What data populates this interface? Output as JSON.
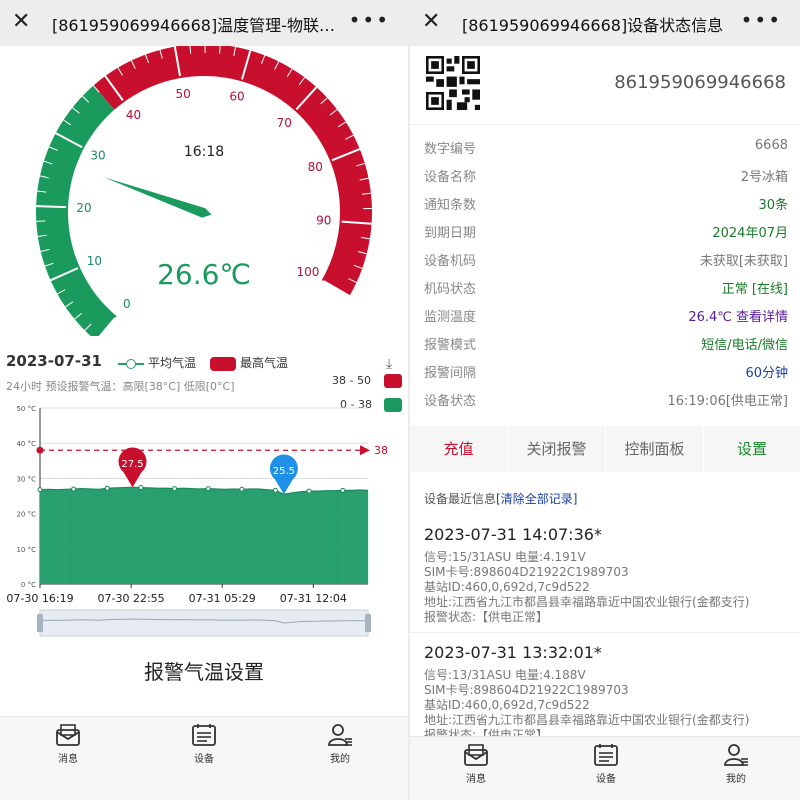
{
  "left": {
    "title": "[861959069946668]温度管理-物联…",
    "gauge": {
      "value": 26.6,
      "value_text": "26.6℃",
      "time": "16:18",
      "min": 0,
      "max": 100,
      "tick_labels": [
        "0",
        "10",
        "20",
        "30",
        "40",
        "50",
        "60",
        "70",
        "80",
        "90",
        "100"
      ],
      "green_until": 38,
      "green_color": "#1a9a5c",
      "red_color": "#c8102e"
    },
    "chart_header": {
      "date": "2023-07-31",
      "legend_avg": "平均气温",
      "legend_max": "最高气温",
      "subtitle": "24小时  预设报警气温：高限[38°C] 低限[0°C]",
      "range_high": "38 - 50",
      "range_low": "0 - 38"
    },
    "chart_data": {
      "type": "area",
      "ylim": [
        0,
        50
      ],
      "y_tick_labels": [
        "50 °C",
        "40 °C",
        "30 °C",
        "20 °C",
        "10 °C",
        "0 °C"
      ],
      "x_tick_labels": [
        "07-30 16:19",
        "07-30 22:55",
        "07-31 05:29",
        "07-31 12:04"
      ],
      "threshold": 38,
      "threshold_label": "38",
      "max_label": "27.5",
      "min_label": "25.5",
      "series": [
        {
          "name": "平均气温",
          "values": [
            26.8,
            26.9,
            26.8,
            26.9,
            27.0,
            27.1,
            27.0,
            26.9,
            27.2,
            27.3,
            27.4,
            27.5,
            27.4,
            27.3,
            27.2,
            27.2,
            27.1,
            27.2,
            27.1,
            27.0,
            27.1,
            27.0,
            26.9,
            27.0,
            26.9,
            27.0,
            27.0,
            26.8,
            26.6,
            25.5,
            25.9,
            26.2,
            26.4,
            26.4,
            26.5,
            26.5,
            26.6,
            26.6,
            26.7,
            26.6
          ]
        }
      ]
    },
    "setting_label": "报警气温设置",
    "tabs": [
      {
        "label": "消息",
        "icon": "message-icon"
      },
      {
        "label": "设备",
        "icon": "device-icon"
      },
      {
        "label": "我的",
        "icon": "profile-icon"
      }
    ]
  },
  "right": {
    "title": "[861959069946668]设备状态信息",
    "device_id": "861959069946668",
    "rows": [
      {
        "key": "数字编号",
        "value": "6668",
        "color": "#777777"
      },
      {
        "key": "设备名称",
        "value": "2号冰箱",
        "color": "#777777"
      },
      {
        "key": "通知条数",
        "value": "30条",
        "color": "#1a7a2a"
      },
      {
        "key": "到期日期",
        "value": "2024年07月",
        "color": "#1a7a2a"
      },
      {
        "key": "设备机码",
        "value": "未获取[未获取]",
        "color": "#777777"
      },
      {
        "key": "机码状态",
        "value": "正常 [在线]",
        "color": "#1a7a2a"
      },
      {
        "key": "监测温度",
        "value": "26.4℃ 查看详情",
        "color": "#5a1a9a"
      },
      {
        "key": "报警模式",
        "value": "短信/电话/微信",
        "color": "#1a7a2a"
      },
      {
        "key": "报警间隔",
        "value": "60分钟",
        "color": "#1a3fa6"
      },
      {
        "key": "设备状态",
        "value": "16:19:06[供电正常]",
        "color": "#777777"
      }
    ],
    "actions": [
      {
        "label": "充值",
        "color": "#c8102e"
      },
      {
        "label": "关闭报警",
        "color": "#666666"
      },
      {
        "label": "控制面板",
        "color": "#666666"
      },
      {
        "label": "设置",
        "color": "#1a8a2a"
      }
    ],
    "logs_head": "设备最近信息",
    "logs_clear": "[清除全部记录]",
    "logs": [
      {
        "time": "2023-07-31 14:07:36*",
        "signal": "信号:15/31ASU 电量:4.191V",
        "sim": "SIM卡号:898604D21922C1989703",
        "station": "基站ID:460,0,692d,7c9d522",
        "address": "地址:江西省九江市都昌县幸福路靠近中国农业银行(金都支行)",
        "status": "报警状态:【供电正常】"
      },
      {
        "time": "2023-07-31 13:32:01*",
        "signal": "信号:13/31ASU 电量:4.188V",
        "sim": "SIM卡号:898604D21922C1989703",
        "station": "基站ID:460,0,692d,7c9d522",
        "address": "地址:江西省九江市都昌县幸福路靠近中国农业银行(金都支行)",
        "status": "报警状态:【供电正常】"
      }
    ],
    "tabs": [
      {
        "label": "消息",
        "icon": "message-icon"
      },
      {
        "label": "设备",
        "icon": "device-icon"
      },
      {
        "label": "我的",
        "icon": "profile-icon"
      }
    ]
  }
}
